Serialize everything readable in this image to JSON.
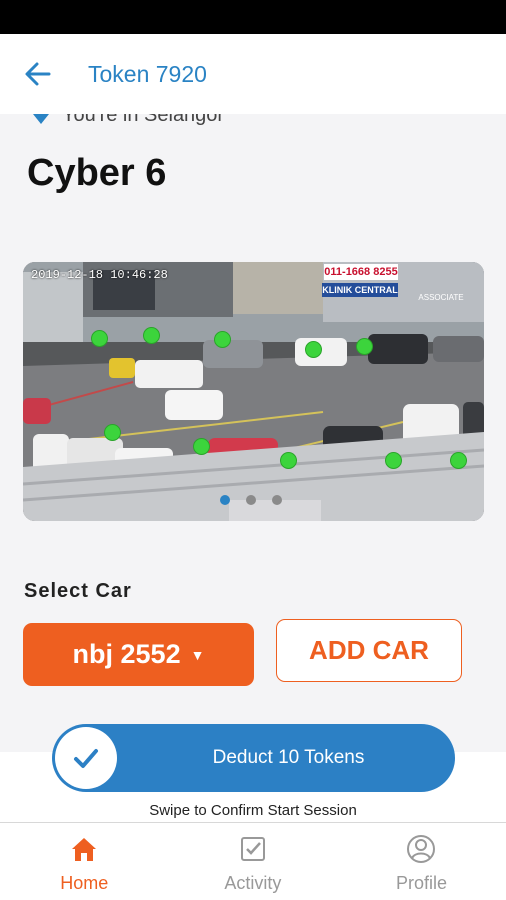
{
  "header": {
    "title": "Token 7920",
    "back_icon": "arrow-left-icon"
  },
  "location": {
    "partial_text": "You're in Selangor",
    "name": "Cyber 6"
  },
  "camera": {
    "timestamp": "2019-12-18 10:46:28",
    "sign_a": "011-1668 8255",
    "sign_b": "KLINIK CENTRAL",
    "sign_c": "ASSOCIATE",
    "pager_count": 3,
    "pager_active": 0
  },
  "car": {
    "section_label": "Select Car",
    "selected": "nbj 2552",
    "add_label": "ADD CAR"
  },
  "swipe": {
    "label": "Deduct 10 Tokens",
    "hint": "Swipe to Confirm Start Session"
  },
  "nav": {
    "items": [
      {
        "label": "Home",
        "icon": "home-icon",
        "active": true
      },
      {
        "label": "Activity",
        "icon": "checkbox-icon",
        "active": false
      },
      {
        "label": "Profile",
        "icon": "user-icon",
        "active": false
      }
    ]
  },
  "colors": {
    "accent": "#EE5F20",
    "primary": "#2A83C4",
    "slot_free": "#3CD43C"
  }
}
